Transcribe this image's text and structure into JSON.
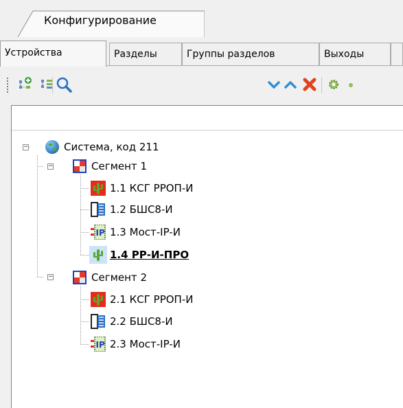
{
  "window": {
    "tab_title": "Конфигурирование"
  },
  "subtabs": [
    {
      "label": "Устройства",
      "active": true
    },
    {
      "label": "Разделы",
      "active": false
    },
    {
      "label": "Группы разделов",
      "active": false
    },
    {
      "label": "Выходы",
      "active": false
    },
    {
      "label": "",
      "active": false
    }
  ],
  "toolbar": {
    "icons": [
      "add-device-icon",
      "add-child-icon",
      "search-icon",
      "move-down-icon",
      "move-up-icon",
      "delete-icon",
      "settings-icon"
    ]
  },
  "tree": {
    "root": {
      "label": "Система, код 211",
      "icon": "globe-icon",
      "expanded": true
    },
    "segments": [
      {
        "label": "Сегмент 1",
        "expanded": true,
        "devices": [
          {
            "label": "1.1 КСГ РРОП-И",
            "icon": "cactus-red-icon"
          },
          {
            "label": "1.2 БШС8-И",
            "icon": "board-icon"
          },
          {
            "label": "1.3 Мост-IP-И",
            "icon": "ip-bridge-icon"
          },
          {
            "label": "1.4 РР-И-ПРО",
            "icon": "cactus-icon",
            "selected": true
          }
        ]
      },
      {
        "label": "Сегмент 2",
        "expanded": true,
        "devices": [
          {
            "label": "2.1 КСГ РРОП-И",
            "icon": "cactus-red-icon"
          },
          {
            "label": "2.2 БШС8-И",
            "icon": "board-icon"
          },
          {
            "label": "2.3 Мост-IP-И",
            "icon": "ip-bridge-icon"
          }
        ]
      }
    ]
  }
}
